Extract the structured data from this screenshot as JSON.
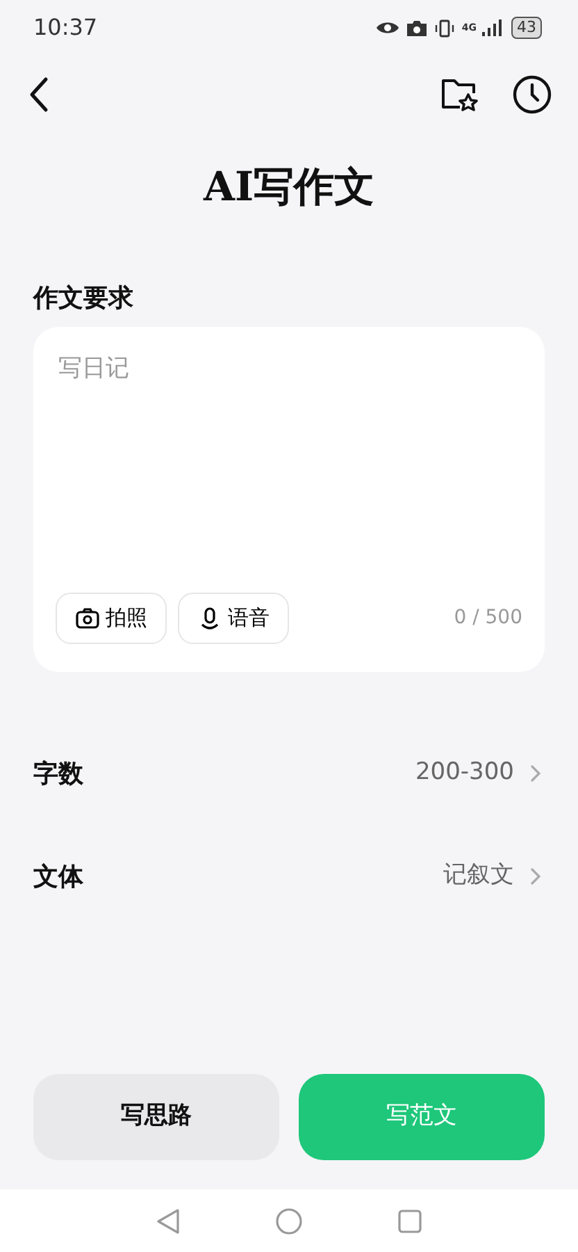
{
  "status_bar": {
    "time": "10:37",
    "network": "4G",
    "battery": "43"
  },
  "title": "AI写作文",
  "section_label": "作文要求",
  "input": {
    "placeholder": "写日记",
    "counter": "0 / 500",
    "tools": [
      {
        "kind": "camera",
        "label": "拍照"
      },
      {
        "kind": "mic",
        "label": "语音"
      }
    ]
  },
  "settings": [
    {
      "label": "字数",
      "value": "200-300"
    },
    {
      "label": "文体",
      "value": "记叙文"
    }
  ],
  "actions": [
    {
      "label": "写思路",
      "primary": false
    },
    {
      "label": "写范文",
      "primary": true
    }
  ]
}
